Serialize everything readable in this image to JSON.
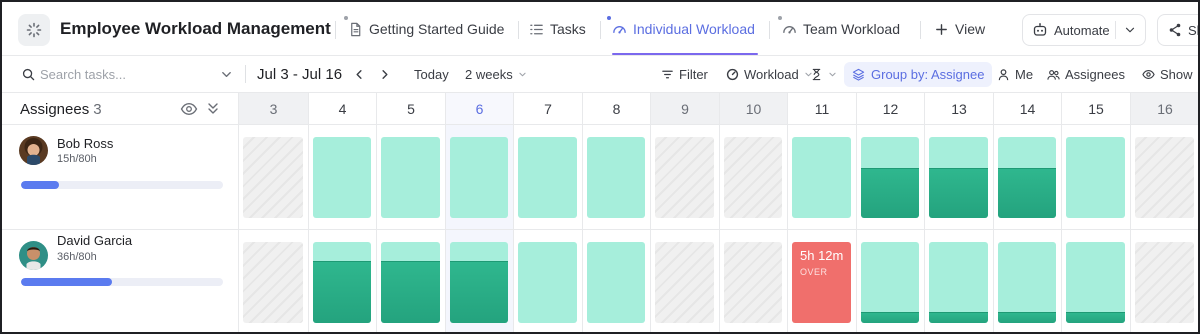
{
  "header": {
    "title": "Employee Workload Management",
    "tabs": [
      {
        "label": "Getting Started Guide",
        "icon": "doc-icon"
      },
      {
        "label": "Tasks",
        "icon": "list-icon"
      },
      {
        "label": "Individual Workload",
        "icon": "gauge-icon",
        "active": true
      },
      {
        "label": "Team Workload",
        "icon": "gauge-icon"
      }
    ],
    "add_view_label": "View",
    "automate_label": "Automate",
    "share_label": "Sha"
  },
  "toolbar": {
    "search_placeholder": "Search tasks...",
    "date_range": "Jul 3 - Jul 16",
    "today_label": "Today",
    "period_label": "2 weeks",
    "filter_label": "Filter",
    "workload_label": "Workload",
    "group_by_label": "Group by: Assignee",
    "me_label": "Me",
    "assignees_label": "Assignees",
    "show_label": "Show"
  },
  "grid": {
    "assignees_label": "Assignees",
    "assignees_count": "3",
    "days": [
      {
        "label": "3",
        "weekend": true
      },
      {
        "label": "4"
      },
      {
        "label": "5"
      },
      {
        "label": "6",
        "today": true
      },
      {
        "label": "7"
      },
      {
        "label": "8"
      },
      {
        "label": "9",
        "weekend": true
      },
      {
        "label": "10",
        "weekend": true
      },
      {
        "label": "11"
      },
      {
        "label": "12"
      },
      {
        "label": "13"
      },
      {
        "label": "14"
      },
      {
        "label": "15"
      },
      {
        "label": "16",
        "weekend": true
      }
    ]
  },
  "assignees": [
    {
      "name": "Bob Ross",
      "hours": "15h/80h",
      "progress": 0.19,
      "avatar": "avatar-bob-icon",
      "cells": [
        {
          "type": "off"
        },
        {
          "type": "work",
          "load": 0
        },
        {
          "type": "work",
          "load": 0
        },
        {
          "type": "work",
          "load": 0
        },
        {
          "type": "work",
          "load": 0
        },
        {
          "type": "work",
          "load": 0
        },
        {
          "type": "off"
        },
        {
          "type": "off"
        },
        {
          "type": "work",
          "load": 0
        },
        {
          "type": "work",
          "load": 0.62
        },
        {
          "type": "work",
          "load": 0.62
        },
        {
          "type": "work",
          "load": 0.62
        },
        {
          "type": "work",
          "load": 0
        },
        {
          "type": "off"
        }
      ]
    },
    {
      "name": "David Garcia",
      "hours": "36h/80h",
      "progress": 0.45,
      "avatar": "avatar-david-icon",
      "cells": [
        {
          "type": "off"
        },
        {
          "type": "work",
          "load": 0.76
        },
        {
          "type": "work",
          "load": 0.76
        },
        {
          "type": "work",
          "load": 0.76
        },
        {
          "type": "work",
          "load": 0
        },
        {
          "type": "work",
          "load": 0
        },
        {
          "type": "off"
        },
        {
          "type": "off"
        },
        {
          "type": "over",
          "time": "5h 12m",
          "label": "OVER"
        },
        {
          "type": "work",
          "load": 0.14
        },
        {
          "type": "work",
          "load": 0.14
        },
        {
          "type": "work",
          "load": 0.14
        },
        {
          "type": "work",
          "load": 0.14
        },
        {
          "type": "off"
        }
      ]
    }
  ],
  "colors": {
    "accent": "#7b68ee",
    "active_tab": "#5b6ee1",
    "capacity": "#a6eedb",
    "load": "#2fb78e",
    "overload": "#f06f6c",
    "progress": "#5b7bef"
  }
}
